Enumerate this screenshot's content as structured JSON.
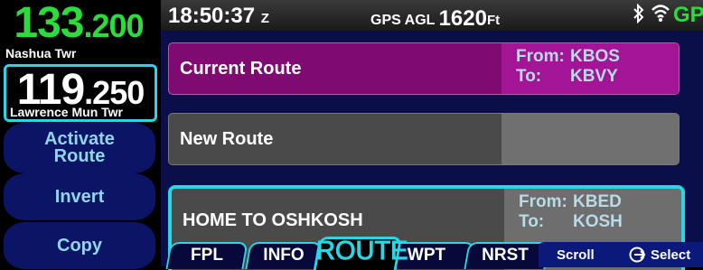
{
  "com": {
    "active_freq_main": "133",
    "active_freq_dec": ".200",
    "active_name": "Nashua Twr",
    "standby_freq_main": "119",
    "standby_freq_dec": ".250",
    "standby_name": "Lawrence Mun Twr"
  },
  "softkeys": {
    "activate_line1": "Activate",
    "activate_line2": "Route",
    "invert": "Invert",
    "copy": "Copy"
  },
  "status": {
    "time": "18:50:37",
    "time_suffix": "Z",
    "agl_label": "GPS AGL",
    "agl_value": "1620",
    "agl_unit": "Ft",
    "gps": "GPS",
    "icons": [
      "bluetooth-icon",
      "wifi-icon"
    ]
  },
  "routes": [
    {
      "name": "Current Route",
      "from_label": "From:",
      "from": "KBOS",
      "to_label": "To:",
      "to": "KBVY"
    },
    {
      "name": "New Route"
    },
    {
      "name": "HOME TO OSHKOSH",
      "from_label": "From:",
      "from": "KBED",
      "to_label": "To:",
      "to": "KOSH"
    }
  ],
  "tabs": [
    {
      "label": "FPL"
    },
    {
      "label": "INFO"
    },
    {
      "label": "ROUTE",
      "active": true
    },
    {
      "label": "WPT"
    },
    {
      "label": "NRST"
    }
  ],
  "hint": {
    "scroll": "Scroll",
    "select": "Select"
  },
  "colors": {
    "green": "#2bdc3c",
    "cyan": "#2ad6e6",
    "current_route": "#7e0a72",
    "softkey": "#0c1466"
  }
}
